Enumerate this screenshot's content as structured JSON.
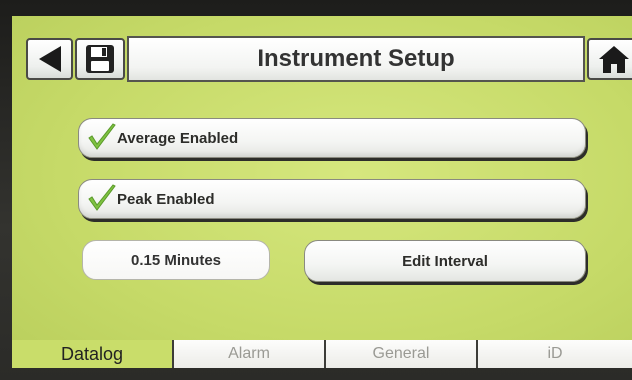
{
  "header": {
    "title": "Instrument Setup",
    "back_icon": "back-arrow-icon",
    "save_icon": "floppy-disk-icon",
    "home_icon": "home-icon"
  },
  "options": {
    "average": {
      "label": "Average Enabled",
      "checked": true
    },
    "peak": {
      "label": "Peak Enabled",
      "checked": true
    }
  },
  "interval": {
    "value": "0.15 Minutes",
    "edit_label": "Edit Interval"
  },
  "tabs": [
    {
      "label": "Datalog",
      "active": true
    },
    {
      "label": "Alarm",
      "active": false
    },
    {
      "label": "General",
      "active": false
    },
    {
      "label": "iD",
      "active": false
    }
  ],
  "colors": {
    "screen_bg": "#c9dd6a",
    "check_green": "#7fc241",
    "button_face": "#f4f5f3"
  }
}
